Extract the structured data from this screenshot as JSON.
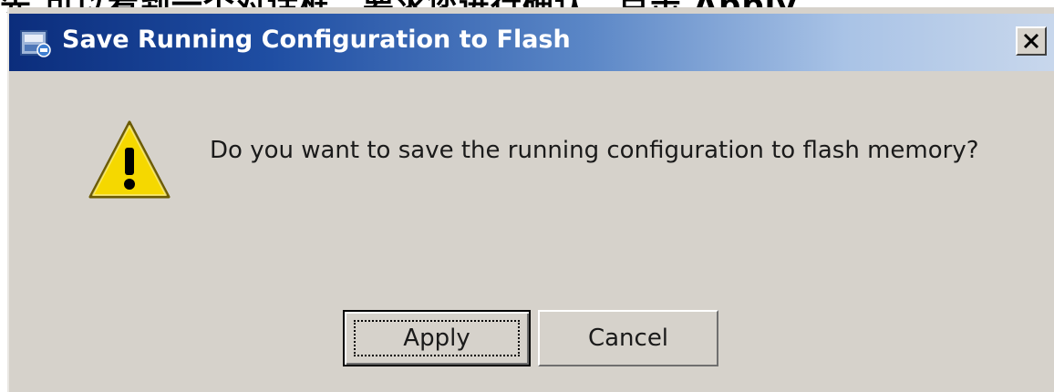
{
  "caption_fragment": "先 可以看到一个对话框，要求您进行确认。点击 Apply。",
  "dialog": {
    "title": "Save Running Configuration to Flash",
    "message": "Do you want to save the running configuration to flash memory?",
    "icons": {
      "app": "app-icon",
      "close": "close-icon",
      "warning": "warning-icon"
    },
    "buttons": {
      "apply_label": "Apply",
      "cancel_label": "Cancel"
    },
    "colors": {
      "title_gradient_start": "#0b2d7c",
      "title_gradient_end": "#c8d7ec",
      "dialog_bg": "#d6d2cb",
      "warning_fill": "#f5d800"
    }
  }
}
